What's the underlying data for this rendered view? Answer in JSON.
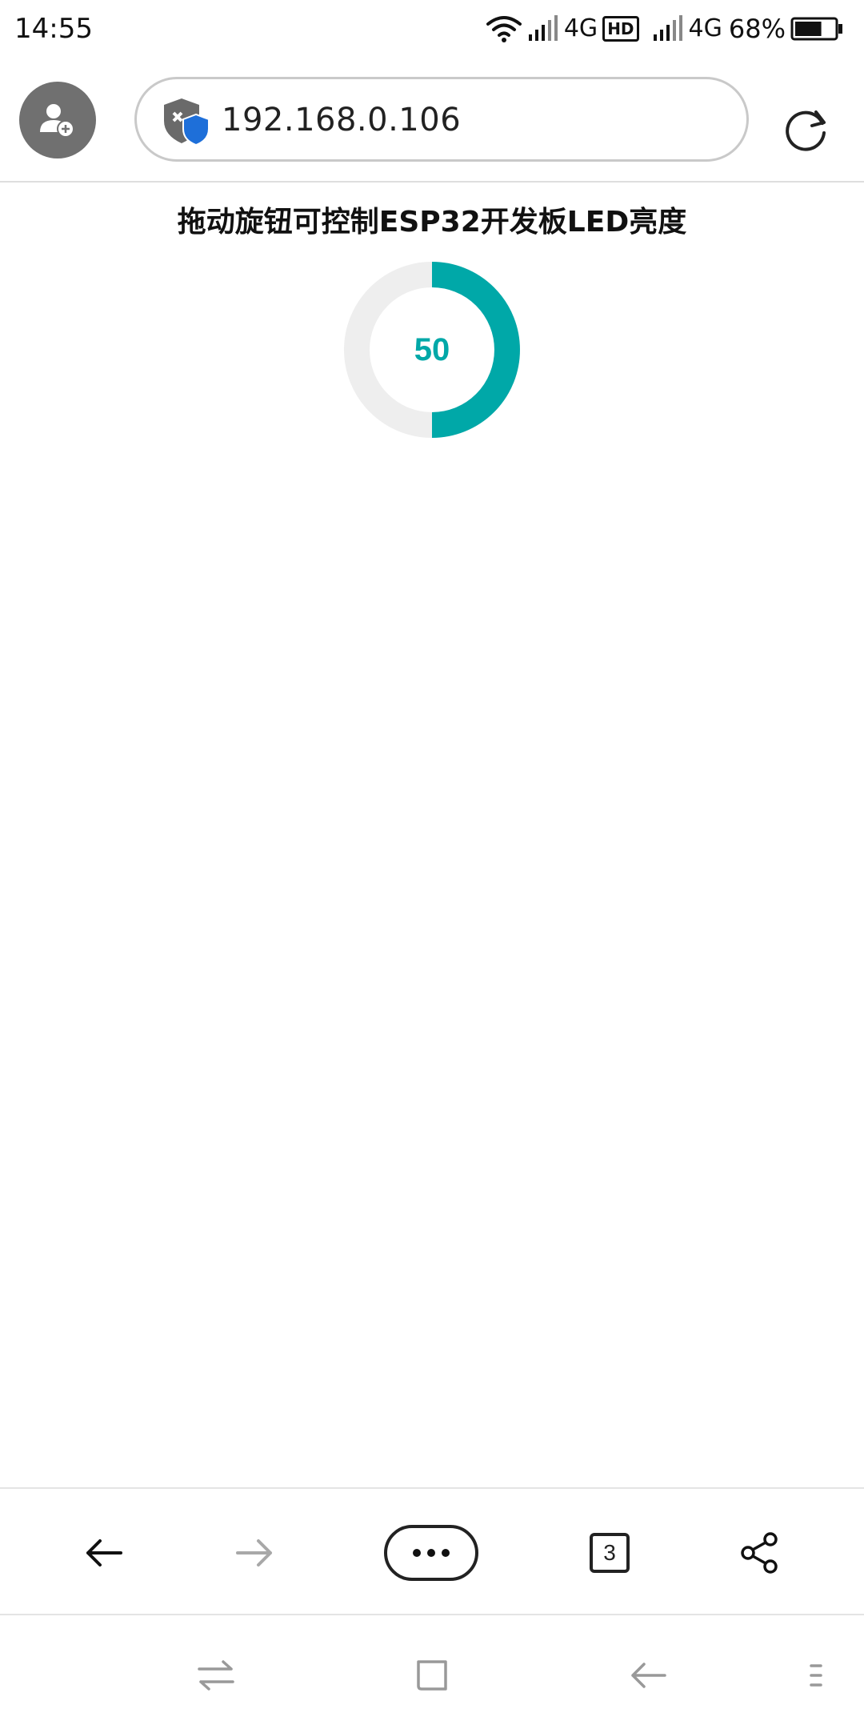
{
  "status_bar": {
    "time": "14:55",
    "sim1_network": "4G",
    "hd_label": "HD",
    "sim2_network": "4G",
    "battery_percent": "68%",
    "battery_level": 0.68,
    "icons": [
      "wifi-icon",
      "signal-icon",
      "signal-icon",
      "battery-icon"
    ]
  },
  "browser": {
    "url": "192.168.0.106",
    "icons": [
      "add-profile-icon",
      "security-shield-icon",
      "reload-icon"
    ]
  },
  "page": {
    "title": "拖动旋钮可控制ESP32开发板LED亮度",
    "knob": {
      "value": "50",
      "min": 0,
      "max": 100,
      "fill_fraction": 0.5,
      "accent_color": "#00a8a8",
      "track_color": "#eeeeee"
    }
  },
  "bottom_toolbar": {
    "tab_count": "3",
    "icons": [
      "back-arrow-icon",
      "forward-arrow-icon",
      "more-dots-icon",
      "tabs-icon",
      "share-icon"
    ]
  },
  "system_nav": {
    "icons": [
      "switch-apps-icon",
      "home-square-icon",
      "back-icon",
      "menu-icon"
    ]
  }
}
